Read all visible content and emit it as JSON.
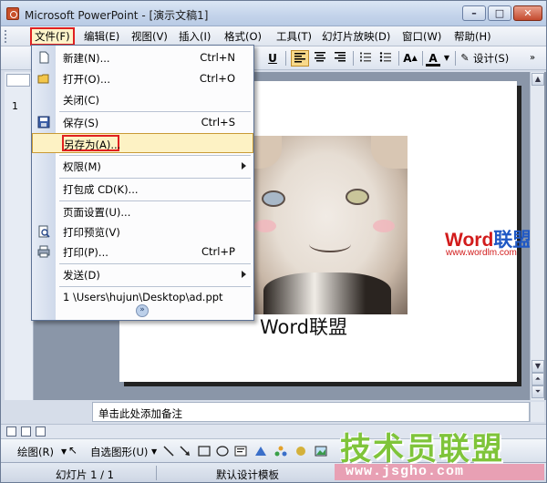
{
  "window": {
    "title": "Microsoft PowerPoint - [演示文稿1]",
    "controls": {
      "minimize": "–",
      "maximize": "□",
      "close": "✕"
    }
  },
  "menubar": {
    "items": [
      {
        "label": "文件(F)",
        "active": true
      },
      {
        "label": "编辑(E)"
      },
      {
        "label": "视图(V)"
      },
      {
        "label": "插入(I)"
      },
      {
        "label": "格式(O)"
      },
      {
        "label": "工具(T)"
      },
      {
        "label": "幻灯片放映(D)"
      },
      {
        "label": "窗口(W)"
      },
      {
        "label": "帮助(H)"
      }
    ]
  },
  "toolbar": {
    "underline": "U",
    "font_grow": "A",
    "font_color": "A",
    "design_label": "设计(S)"
  },
  "file_menu": {
    "items": [
      {
        "label": "新建(N)...",
        "shortcut": "Ctrl+N",
        "icon": "new-doc-icon"
      },
      {
        "label": "打开(O)...",
        "shortcut": "Ctrl+O",
        "icon": "open-folder-icon"
      },
      {
        "label": "关闭(C)"
      },
      {
        "label": "保存(S)",
        "shortcut": "Ctrl+S",
        "icon": "save-disk-icon"
      },
      {
        "label": "另存为(A)...",
        "highlighted": true
      },
      {
        "label": "权限(M)",
        "submenu": true
      },
      {
        "label": "打包成 CD(K)..."
      },
      {
        "label": "页面设置(U)..."
      },
      {
        "label": "打印预览(V)",
        "icon": "print-preview-icon"
      },
      {
        "label": "打印(P)...",
        "shortcut": "Ctrl+P",
        "icon": "printer-icon"
      },
      {
        "label": "发送(D)",
        "submenu": true
      },
      {
        "label": "1 \\Users\\hujun\\Desktop\\ad.ppt"
      }
    ]
  },
  "left_pane": {
    "slide_number": "1"
  },
  "slide": {
    "caption": "Word联盟",
    "watermark_brand_w": "Word",
    "watermark_brand_rest": "联盟",
    "watermark_url": "www.wordlm.com"
  },
  "notes": {
    "placeholder": "单击此处添加备注"
  },
  "draw_toolbar": {
    "draw_label": "绘图(R)",
    "autoshapes_label": "自选图形(U)"
  },
  "status": {
    "slide_position": "幻灯片 1 / 1",
    "template": "默认设计模板"
  },
  "corner_watermark": {
    "title": "技术员联盟",
    "url": "www.jsgho.com"
  },
  "colors": {
    "highlight_red": "#e02020",
    "menu_hover": "#fdf2c4",
    "watermark_green": "#7fc43a"
  }
}
